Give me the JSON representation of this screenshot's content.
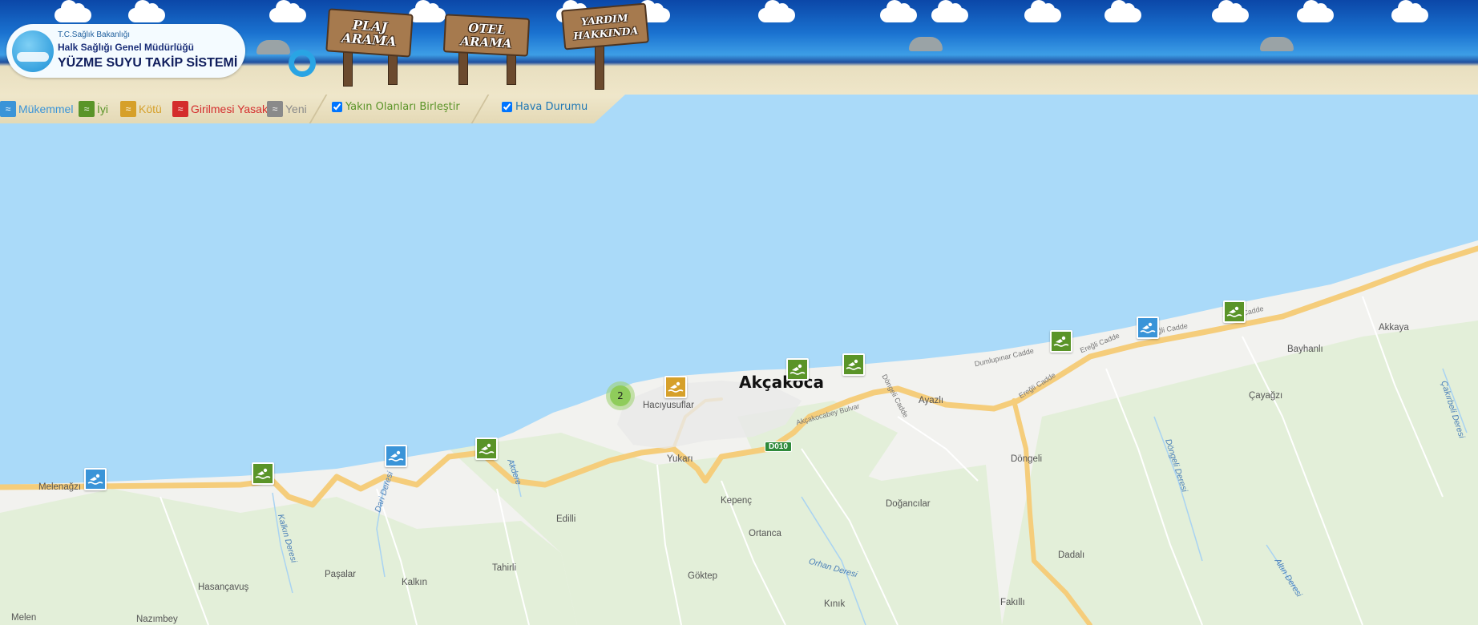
{
  "header": {
    "logo": {
      "ministry": "T.C.Sağlık Bakanlığı",
      "directorate": "Halk Sağlığı Genel Müdürlüğü",
      "system": "YÜZME SUYU TAKİP SİSTEMİ"
    },
    "signs": {
      "plaj": [
        "PLAJ",
        "ARAMA"
      ],
      "otel": [
        "OTEL",
        "ARAMA"
      ],
      "yardim": [
        "YARDIM",
        "HAKKINDA"
      ]
    }
  },
  "legend": {
    "items": [
      {
        "label": "Mükemmel",
        "color": "#3a94d8"
      },
      {
        "label": "İyi",
        "color": "#5a9428"
      },
      {
        "label": "Kötü",
        "color": "#d6a02a"
      },
      {
        "label": "Girilmesi Yasak",
        "color": "#d42d2d"
      },
      {
        "label": "Yeni",
        "color": "#8a8a8a"
      }
    ],
    "merge_nearby": {
      "label": "Yakın Olanları Birleştir",
      "checked": true
    },
    "weather": {
      "label": "Hava Durumu",
      "checked": true
    }
  },
  "map": {
    "sea_color": "#aadaf9",
    "land_color": "#f2f2ef",
    "road_color": "#f5cd7b",
    "cluster": {
      "count": "2"
    },
    "markers": [
      {
        "status": "Mükemmel",
        "color": "#3a94d8"
      },
      {
        "status": "İyi",
        "color": "#5a9428"
      },
      {
        "status": "Mükemmel",
        "color": "#3a94d8"
      },
      {
        "status": "İyi",
        "color": "#5a9428"
      },
      {
        "status": "Kötü",
        "color": "#d6a02a"
      },
      {
        "status": "İyi",
        "color": "#5a9428"
      },
      {
        "status": "İyi",
        "color": "#5a9428"
      },
      {
        "status": "İyi",
        "color": "#5a9428"
      },
      {
        "status": "Mükemmel",
        "color": "#3a94d8"
      },
      {
        "status": "İyi",
        "color": "#5a9428"
      }
    ],
    "labels": {
      "akcakoca": "Akçakoca",
      "haciyusuflar": "Hacıyusuflar",
      "melenagzi": "Melenağzı",
      "yukari": "Yukarı",
      "kepenc": "Kepenç",
      "ortanca": "Ortanca",
      "edilli": "Edilli",
      "pasalar": "Paşalar",
      "hasancavus": "Hasançavuş",
      "kalkin": "Kalkın",
      "tahirli": "Tahirli",
      "goktepe": "Göktep",
      "kinik": "Kınık",
      "fakilli": "Fakıllı",
      "dadali": "Dadalı",
      "dogancilar": "Doğancılar",
      "dongeli": "Döngeli",
      "ayazli": "Ayazlı",
      "akkaya": "Akkaya",
      "bayhanli": "Bayhanlı",
      "cayagzi": "Çayağzı",
      "melen": "Melen",
      "nazimbey": "Nazımbey",
      "dumlupinar": "Dumlupınar Cadde",
      "eregli1": "Ereğli Cadde",
      "eregli2": "Ereğli Cadde",
      "eregli3": "Ereğli Cadde",
      "eregli4": "Ereğli Cadde",
      "akcakocabey": "Akçakocabey Bulvar",
      "dongelicadde": "Döngeli Cadde",
      "kalkinderesi": "Kalkın Deresi",
      "darideresi": "Dari Deresi",
      "akdere": "Akdere",
      "orhanderesi": "Orhan Deresi",
      "dongelideresi": "Döngeli Deresi",
      "altinderesi": "Altın Deresi",
      "cakirbeli": "Çakırbeli Deresi"
    },
    "road_shield": "D010"
  }
}
